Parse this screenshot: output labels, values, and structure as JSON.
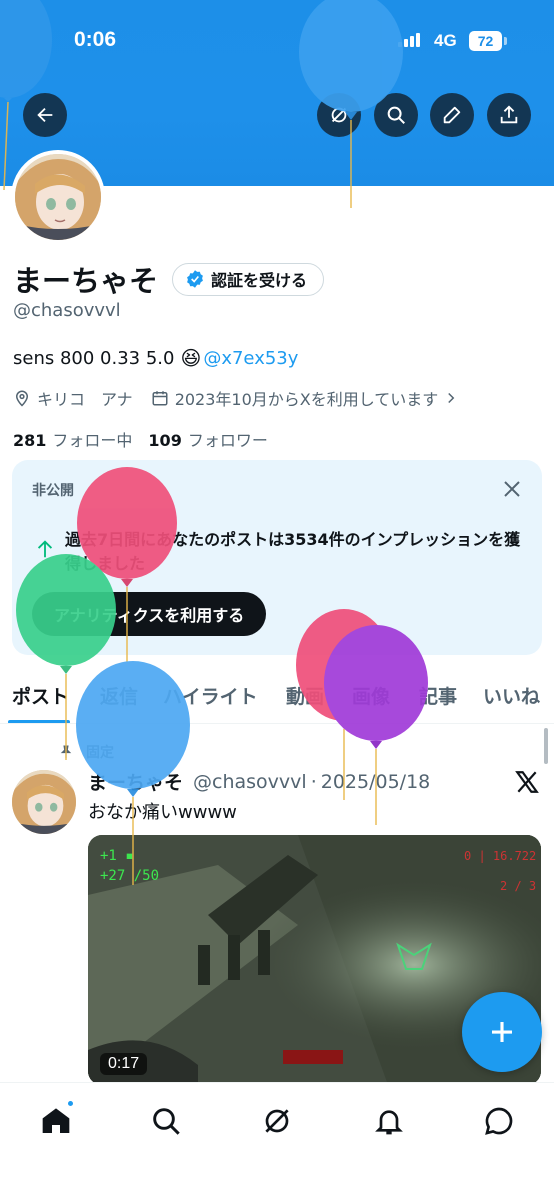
{
  "status_bar": {
    "time": "0:06",
    "network": "4G",
    "battery": "72"
  },
  "profile": {
    "display_name": "まーちゃそ",
    "verify_label": "認証を受ける",
    "handle": "@chasovvvl",
    "bio_text": "sens 800 0.33 5.0",
    "bio_emoji": "😆",
    "bio_mention": "@x7ex53y",
    "location": "キリコ　アナ",
    "joined": "2023年10月からXを利用しています",
    "following_count": "281",
    "following_label": "フォロー中",
    "followers_count": "109",
    "followers_label": "フォロワー"
  },
  "private_card": {
    "label": "非公開",
    "impression_text": "過去7日間にあなたのポストは3534件のインプレッションを獲得しました",
    "button_label": "アナリティクスを利用する"
  },
  "tabs": [
    "ポスト",
    "返信",
    "ハイライト",
    "動画",
    "画像",
    "記事",
    "いいね"
  ],
  "pinned_post": {
    "pinned_label": "固定",
    "author_name": "まーちゃそ",
    "author_handle": "@chasovvvl",
    "separator": "·",
    "date": "2025/05/18",
    "text": "おなか痛いwwww",
    "video_duration": "0:17"
  },
  "colors": {
    "brand_blue": "#1d9bf0",
    "banner_blue": "#1d8fe8",
    "text_primary": "#0f1419",
    "text_secondary": "#536471"
  },
  "icons": [
    "back-arrow-icon",
    "grok-icon",
    "search-icon",
    "edit-icon",
    "share-icon",
    "verified-badge-icon",
    "location-icon",
    "calendar-icon",
    "chevron-right-icon",
    "close-icon",
    "impression-arrow-icon",
    "pin-icon",
    "x-logo-icon",
    "compose-plus-icon",
    "home-icon",
    "explore-icon",
    "grok-nav-icon",
    "notifications-icon",
    "messages-icon"
  ]
}
